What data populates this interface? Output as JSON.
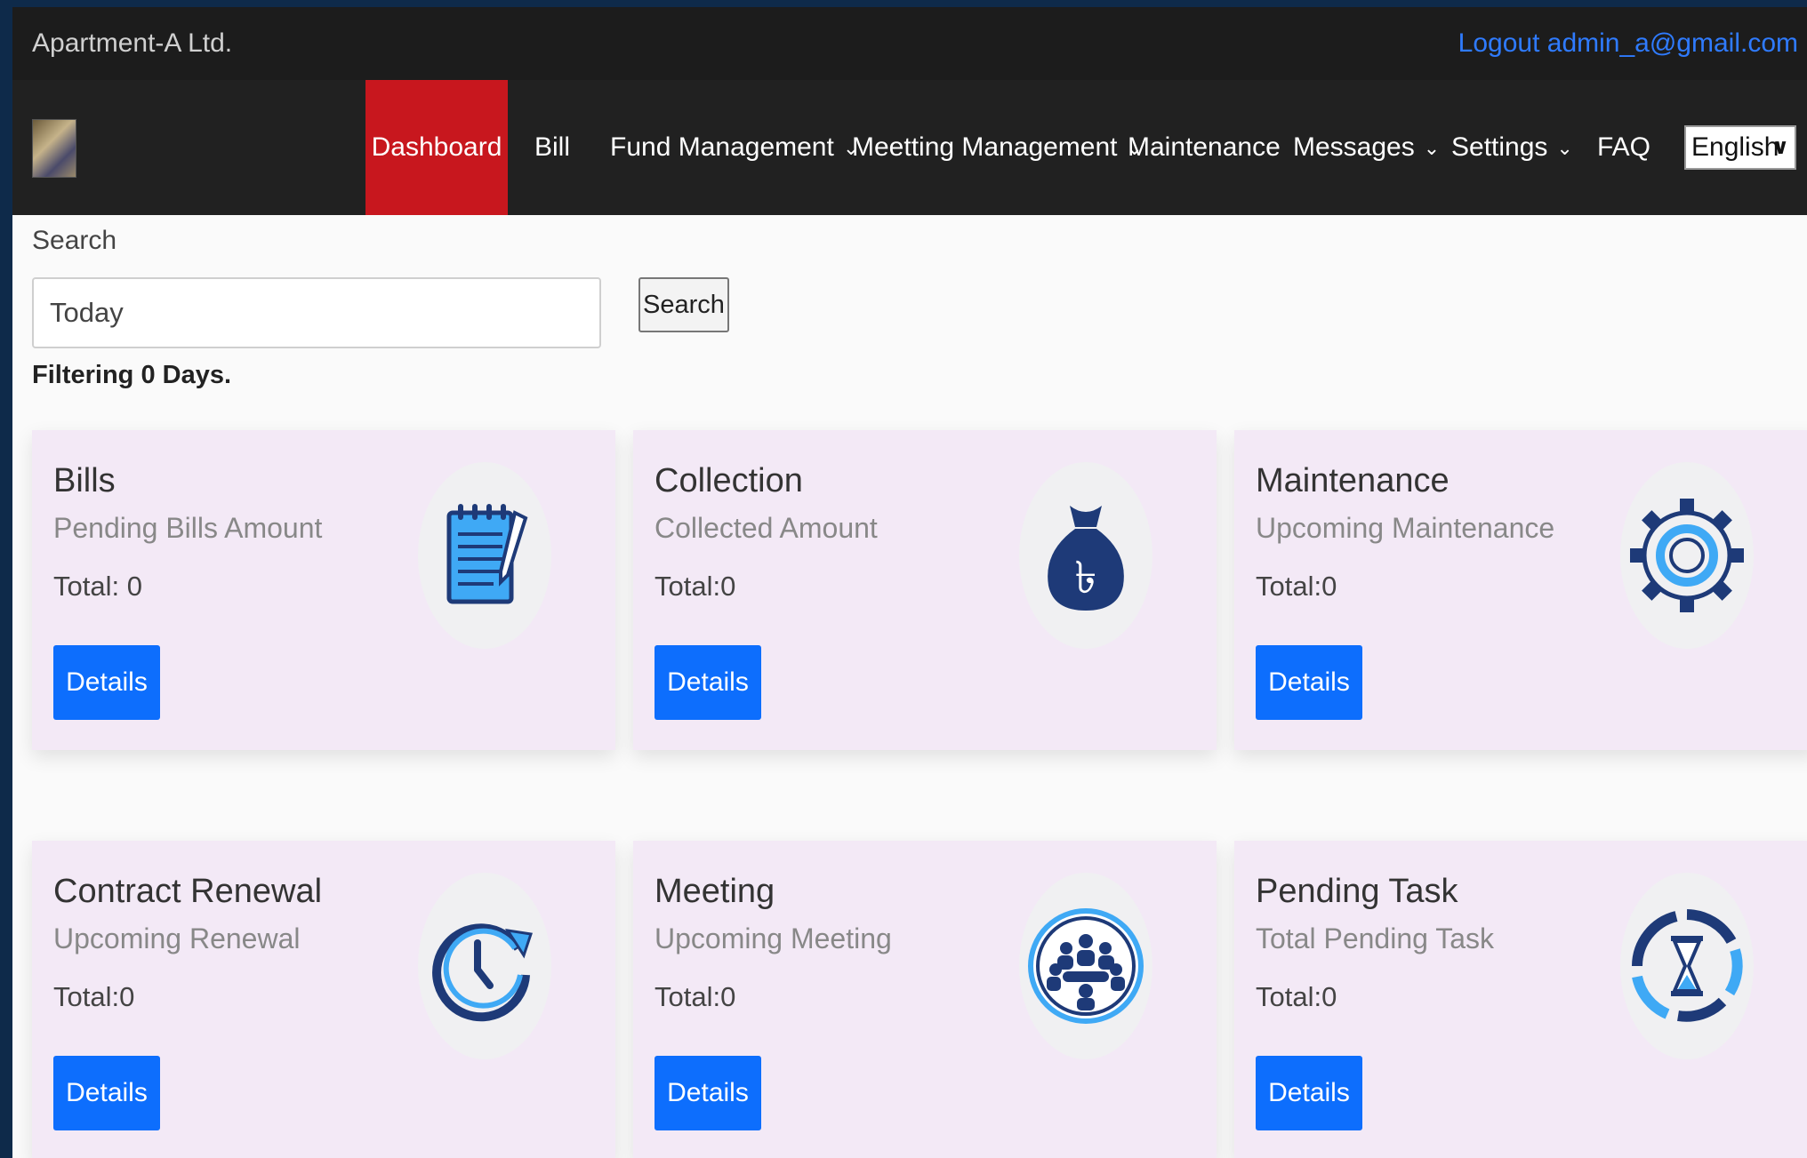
{
  "header": {
    "brand": "Apartment-A Ltd.",
    "logout": "Logout admin_a@gmail.com"
  },
  "nav": {
    "items": [
      {
        "label": "Dashboard",
        "active": true
      },
      {
        "label": "Bill"
      },
      {
        "label": "Fund Management",
        "dropdown": true
      },
      {
        "label": "Meetting Management",
        "dropdown": true
      },
      {
        "label": "Maintenance"
      },
      {
        "label": "Messages",
        "dropdown": true
      },
      {
        "label": "Settings",
        "dropdown": true
      },
      {
        "label": "FAQ"
      }
    ],
    "language": "English"
  },
  "search": {
    "label": "Search",
    "value": "Today",
    "button": "Search",
    "filter_text": "Filtering 0 Days."
  },
  "cards": [
    {
      "title": "Bills",
      "subtitle": "Pending Bills Amount",
      "total": "Total: 0",
      "button": "Details",
      "icon": "notepad-icon"
    },
    {
      "title": "Collection",
      "subtitle": "Collected Amount",
      "total": "Total:0",
      "button": "Details",
      "icon": "money-bag-icon"
    },
    {
      "title": "Maintenance",
      "subtitle": "Upcoming Maintenance",
      "total": "Total:0",
      "button": "Details",
      "icon": "gear-icon"
    },
    {
      "title": "Contract Renewal",
      "subtitle": "Upcoming Renewal",
      "total": "Total:0",
      "button": "Details",
      "icon": "clock-renew-icon"
    },
    {
      "title": "Meeting",
      "subtitle": "Upcoming Meeting",
      "total": "Total:0",
      "button": "Details",
      "icon": "meeting-icon"
    },
    {
      "title": "Pending Task",
      "subtitle": "Total Pending Task",
      "total": "Total:0",
      "button": "Details",
      "icon": "hourglass-icon"
    }
  ],
  "colors": {
    "active_nav": "#c8171e",
    "link": "#2f7bff",
    "button": "#0d6efd",
    "card_bg": "#f3e9f6",
    "icon_dark": "#1e3a78",
    "icon_light": "#3fa9f5"
  }
}
